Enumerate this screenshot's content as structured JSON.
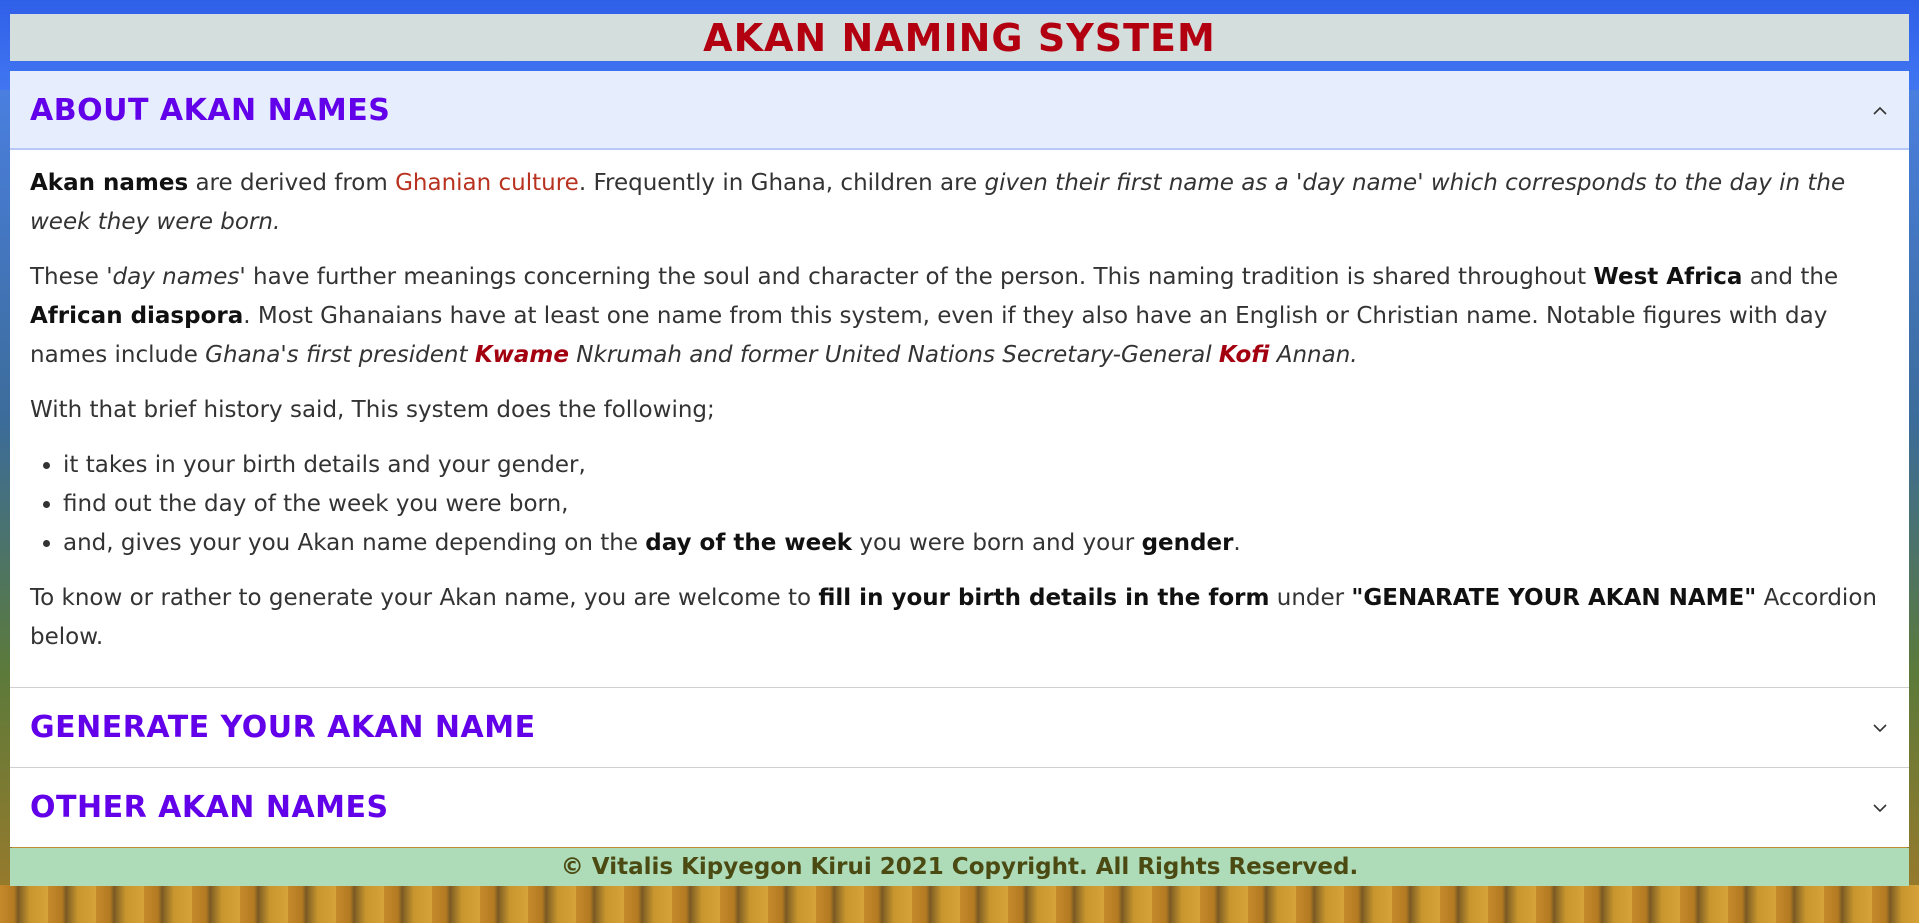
{
  "page": {
    "title": "AKAN NAMING SYSTEM"
  },
  "accordion": {
    "about": {
      "header": "ABOUT AKAN NAMES",
      "p1": {
        "s1_bold": "Akan names",
        "s2": " are derived from ",
        "s3_link": "Ghanian culture",
        "s4": ". Frequently in Ghana, children are ",
        "s5_italic": "given their first name as a 'day name' which corresponds to the day in the week they were born."
      },
      "p2": {
        "s1": "These ",
        "s2_italic": "'day names'",
        "s3": " have further meanings concerning the soul and character of the person. This naming tradition is shared throughout ",
        "s4_bold": "West Africa",
        "s5": " and the ",
        "s6_bold": "African diaspora",
        "s7": ". Most Ghanaians have at least one name from this system, even if they also have an English or Christian name. Notable figures with day names include ",
        "s8_italic": "Ghana's first president ",
        "s9_name": "Kwame",
        "s10_italic": " Nkrumah and former United Nations Secretary-General ",
        "s11_name": "Kofi",
        "s12_italic": " Annan."
      },
      "p3": "With that brief history said, This system does the following;",
      "list": {
        "item1": "it takes in your birth details and your gender,",
        "item2": "find out the day of the week you were born,",
        "item3": {
          "s1": "and, gives your you Akan name depending on the ",
          "s2_bold": "day of the week",
          "s3": " you were born and your ",
          "s4_bold": "gender",
          "s5": "."
        }
      },
      "p4": {
        "s1": "To know or rather to generate your Akan name, you are welcome to ",
        "s2_bold": "fill in your birth details in the form",
        "s3": " under ",
        "s4_bold": "\"GENARATE YOUR AKAN NAME\"",
        "s5": " Accordion below."
      }
    },
    "generate": {
      "header": "GENERATE YOUR AKAN NAME"
    },
    "other": {
      "header": "OTHER AKAN NAMES"
    }
  },
  "footer": {
    "text": "© Vitalis Kipyegon Kirui 2021 Copyright. All Rights Reserved."
  },
  "icons": {
    "expanded": "chevron-up-icon",
    "collapsed": "chevron-down-icon"
  },
  "colors": {
    "title": "#b30010",
    "accordion_header": "#6200ea",
    "footer_bg": "#aedcb9",
    "footer_text": "#4b4a12",
    "link": "#b8321f"
  }
}
